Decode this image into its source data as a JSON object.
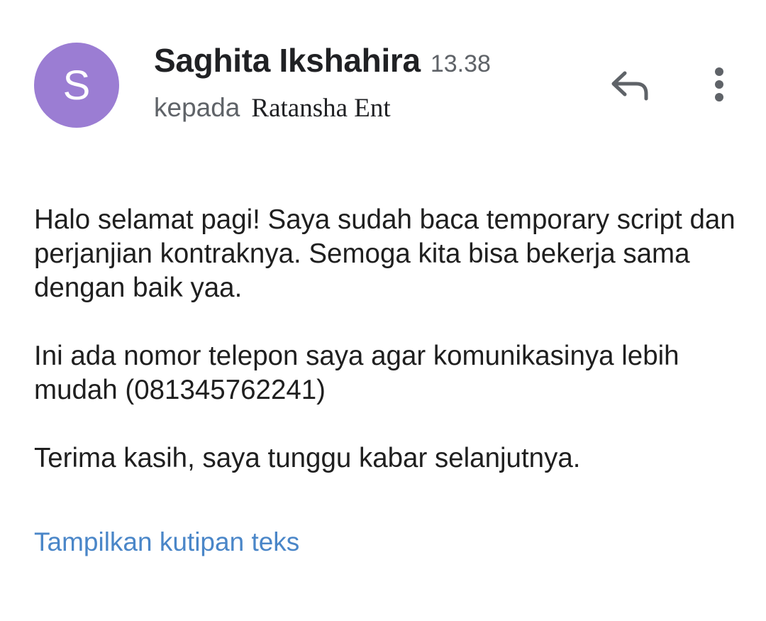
{
  "message": {
    "avatar_letter": "S",
    "avatar_color": "#9b7dd3",
    "sender_name": "Saghita Ikshahira",
    "time": "13.38",
    "to_label": "kepada",
    "recipient": "Ratansha Ent",
    "body": [
      "Halo selamat pagi! Saya sudah baca temporary script dan perjanjian kontraknya. Semoga kita bisa bekerja sama dengan baik yaa.",
      "Ini ada nomor telepon saya agar komunikasinya lebih mudah (081345762241)",
      "Terima kasih, saya tunggu kabar selanjutnya."
    ],
    "show_quoted_label": "Tampilkan kutipan teks",
    "link_color": "#4a86c8"
  },
  "actions": {
    "reply_icon": "reply-icon",
    "more_icon": "more-vert-icon"
  }
}
